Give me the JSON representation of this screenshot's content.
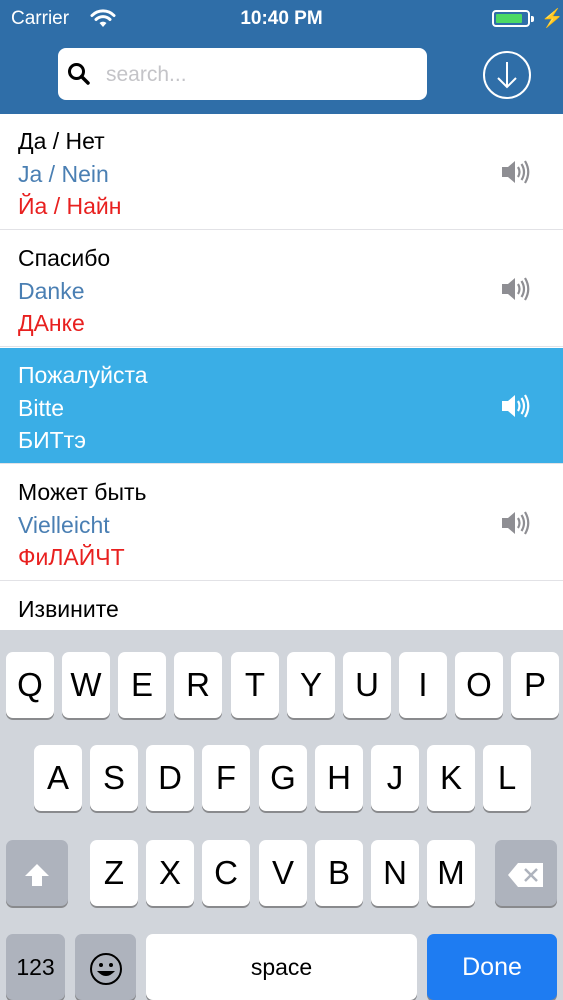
{
  "status": {
    "carrier": "Carrier",
    "time": "10:40 PM"
  },
  "search": {
    "placeholder": "search..."
  },
  "phrases": [
    {
      "ru": "Да / Нет",
      "de": "Ja / Nein",
      "pron": "Йа / Найн"
    },
    {
      "ru": "Спасибо",
      "de": "Danke",
      "pron": "ДАнке"
    },
    {
      "ru": "Пожалуйста",
      "de": "Bitte",
      "pron": "БИТтэ"
    },
    {
      "ru": "Может быть",
      "de": "Vielleicht",
      "pron": "ФиЛАЙЧТ"
    },
    {
      "ru": "Извините",
      "de": "",
      "pron": ""
    }
  ],
  "keyboard": {
    "row1": [
      "Q",
      "W",
      "E",
      "R",
      "T",
      "Y",
      "U",
      "I",
      "O",
      "P"
    ],
    "row2": [
      "A",
      "S",
      "D",
      "F",
      "G",
      "H",
      "J",
      "K",
      "L"
    ],
    "row3": [
      "Z",
      "X",
      "C",
      "V",
      "B",
      "N",
      "M"
    ],
    "numbers": "123",
    "space": "space",
    "done": "Done"
  },
  "colors": {
    "nav": "#2f6ea8",
    "selected_row": "#3aaee6",
    "german": "#4a7fb3",
    "pronunciation": "#e8201f",
    "done_key": "#1e7cf2"
  }
}
